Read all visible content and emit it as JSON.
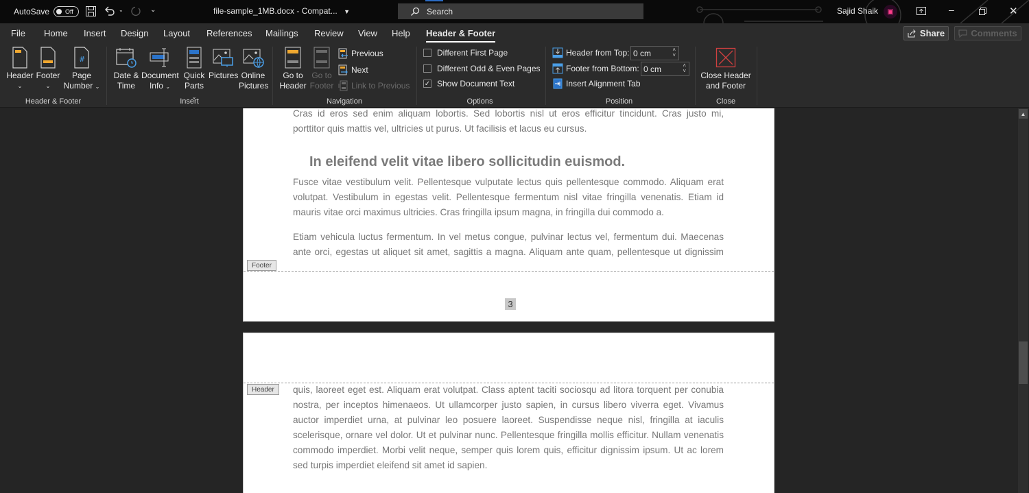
{
  "titlebar": {
    "autosave_label": "AutoSave",
    "autosave_state": "Off",
    "document_title": "file-sample_1MB.docx  -  Compat...",
    "search_placeholder": "Search",
    "user_name": "Sajid Shaik"
  },
  "menu": {
    "tabs": [
      "File",
      "Home",
      "Insert",
      "Design",
      "Layout",
      "References",
      "Mailings",
      "Review",
      "View",
      "Help",
      "Header & Footer"
    ],
    "active_tab": "Header & Footer",
    "share_label": "Share",
    "comments_label": "Comments"
  },
  "ribbon": {
    "groups": {
      "header_footer": {
        "label": "Header & Footer",
        "header": "Header",
        "footer": "Footer",
        "page_number_1": "Page",
        "page_number_2": "Number"
      },
      "insert": {
        "label": "Insert",
        "date_time_1": "Date &",
        "date_time_2": "Time",
        "doc_info_1": "Document",
        "doc_info_2": "Info",
        "quick_parts_1": "Quick",
        "quick_parts_2": "Parts",
        "pictures": "Pictures",
        "online_pictures_1": "Online",
        "online_pictures_2": "Pictures"
      },
      "navigation": {
        "label": "Navigation",
        "go_to_header_1": "Go to",
        "go_to_header_2": "Header",
        "go_to_footer_1": "Go to",
        "go_to_footer_2": "Footer",
        "previous": "Previous",
        "next": "Next",
        "link_to_previous": "Link to Previous"
      },
      "options": {
        "label": "Options",
        "different_first_page": "Different First Page",
        "different_first_page_checked": false,
        "different_odd_even": "Different Odd & Even Pages",
        "different_odd_even_checked": false,
        "show_document_text": "Show Document Text",
        "show_document_text_checked": true
      },
      "position": {
        "label": "Position",
        "header_from_top_label": "Header from Top:",
        "header_from_top_value": "0 cm",
        "footer_from_bottom_label": "Footer from Bottom:",
        "footer_from_bottom_value": "0 cm",
        "insert_alignment_tab": "Insert Alignment Tab"
      },
      "close": {
        "label": "Close",
        "close_1": "Close Header",
        "close_2": "and Footer"
      }
    }
  },
  "document": {
    "page1": {
      "para_a_line1": "Cras id eros sed enim aliquam lobortis. Sed lobortis nisl ut eros efficitur tincidunt. Cras justo mi,",
      "para_a_line2": "porttitor quis mattis vel, ultricies ut purus. Ut facilisis et lacus eu cursus.",
      "heading": "In eleifend velit vitae libero sollicitudin euismod.",
      "para_b": "Fusce vitae vestibulum velit. Pellentesque vulputate lectus quis pellentesque commodo. Aliquam erat volutpat. Vestibulum in egestas velit. Pellentesque fermentum nisl vitae fringilla venenatis. Etiam id mauris vitae orci maximus ultricies. Cras fringilla ipsum magna, in fringilla dui commodo a.",
      "para_c": "Etiam vehicula luctus fermentum. In vel metus congue, pulvinar lectus vel, fermentum dui. Maecenas ante orci, egestas ut aliquet sit amet, sagittis a magna. Aliquam ante quam, pellentesque ut dignissim",
      "footer_tag": "Footer",
      "page_number": "3"
    },
    "page2": {
      "header_tag": "Header",
      "para": "quis, laoreet eget est. Aliquam erat volutpat. Class aptent taciti sociosqu ad litora torquent per conubia nostra, per inceptos himenaeos. Ut ullamcorper justo sapien, in cursus libero viverra eget. Vivamus auctor imperdiet urna, at pulvinar leo posuere laoreet. Suspendisse neque nisl, fringilla at iaculis scelerisque, ornare vel dolor. Ut et pulvinar nunc. Pellentesque fringilla mollis efficitur. Nullam venenatis commodo imperdiet. Morbi velit neque, semper quis lorem quis, efficitur dignissim ipsum. Ut ac lorem sed turpis imperdiet eleifend sit amet id sapien."
    }
  },
  "colors": {
    "accent_blue": "#2b6cc4",
    "icon_orange": "#f0a830",
    "close_red": "#d04040",
    "spell_squiggle": "#e03030"
  }
}
